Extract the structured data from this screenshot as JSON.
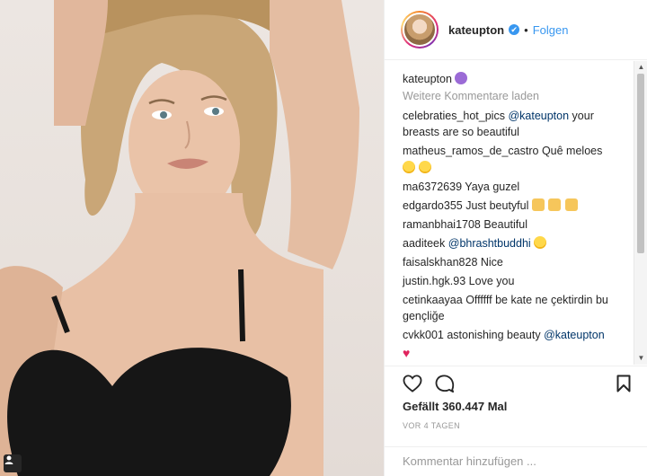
{
  "header": {
    "username": "kateupton",
    "verified_symbol": "✔",
    "separator": "•",
    "follow_label": "Folgen"
  },
  "caption": {
    "username": "kateupton"
  },
  "load_more_label": "Weitere Kommentare laden",
  "comments": [
    {
      "user": "celebraties_hot_pics",
      "mention": "@kateupton",
      "text": " your breasts are so beautiful"
    },
    {
      "user": "matheus_ramos_de_castro",
      "text": " Quê meloes"
    },
    {
      "user": "ma6372639",
      "text": " Yaya guzel"
    },
    {
      "user": "edgardo355",
      "text": " Just beutyful"
    },
    {
      "user": "ramanbhai1708",
      "text": " Beautiful"
    },
    {
      "user": "aaditeek",
      "mention": "@bhrashtbuddhi"
    },
    {
      "user": "faisalskhan828",
      "text": " Nice"
    },
    {
      "user": "justin.hgk.93",
      "text": " Love you"
    },
    {
      "user": "cetinkaayaa",
      "text": " Offffff be kate ne çektirdin bu gençliğe"
    },
    {
      "user": "cvkk001",
      "text": " astonishing beauty ",
      "mention": "@kateupton"
    }
  ],
  "likes": {
    "prefix": "Gefällt ",
    "count": "360.447",
    "suffix": " Mal"
  },
  "time_ago": "VOR 4 TAGEN",
  "add_comment_placeholder": "Kommentar hinzufügen ...",
  "icons": {
    "like": "heart-outline-icon",
    "comment": "speech-bubble-icon",
    "save": "bookmark-icon",
    "photo_badge": "user-tag-icon"
  },
  "colors": {
    "link": "#3897f0",
    "mention": "#003569",
    "muted": "#999999",
    "text": "#262626"
  }
}
